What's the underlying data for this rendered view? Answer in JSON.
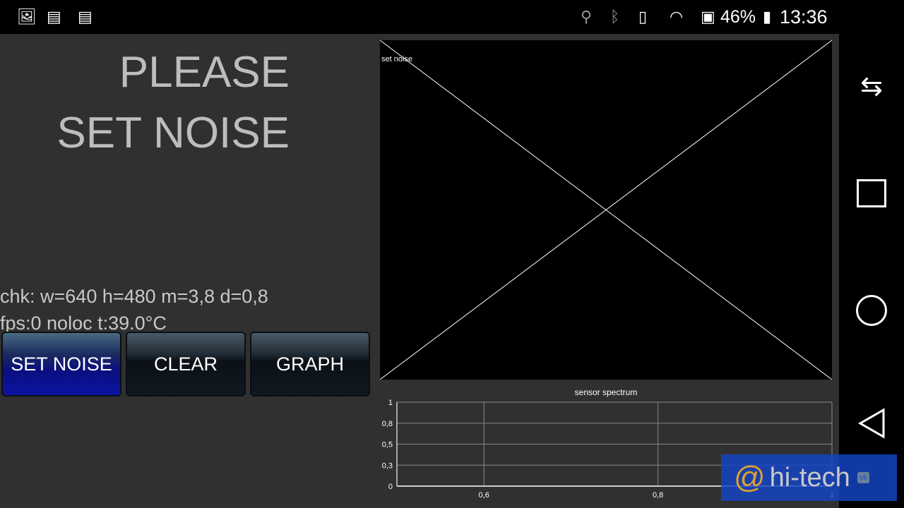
{
  "status_bar": {
    "battery": "46%",
    "time": "13:36",
    "left_icons": [
      "image-icon",
      "calendar-icon",
      "calendar-icon"
    ],
    "right_icons": [
      "location-icon",
      "bluetooth-icon",
      "vibrate-icon",
      "wifi-icon",
      "sd-card-icon",
      "battery-charging-icon"
    ]
  },
  "main": {
    "title_line1": "PLEASE",
    "title_line2": "SET NOISE",
    "info_line1": "chk: w=640 h=480 m=3,8 d=0,8",
    "info_line2": "fps:0 noloc t:39.0°C",
    "buttons": [
      {
        "label": "SET NOISE",
        "active": true
      },
      {
        "label": "CLEAR"
      },
      {
        "label": "GRAPH"
      }
    ],
    "preview_label": "set noise"
  },
  "chart_data": {
    "type": "line",
    "title": "sensor spectrum",
    "xlim": [
      0.5,
      1
    ],
    "ylim": [
      0,
      1
    ],
    "x_ticks": [
      {
        "v": 0.6,
        "label": "0,6"
      },
      {
        "v": 0.8,
        "label": "0,8"
      },
      {
        "v": 1,
        "label": "1"
      }
    ],
    "y_ticks": [
      {
        "v": 0,
        "label": "0"
      },
      {
        "v": 0.25,
        "label": "0,3"
      },
      {
        "v": 0.5,
        "label": "0,5"
      },
      {
        "v": 0.75,
        "label": "0,8"
      },
      {
        "v": 1,
        "label": "1"
      }
    ],
    "grid": true,
    "series": []
  },
  "navbar": {
    "icons": [
      "rotate-icon",
      "recents-icon",
      "home-icon",
      "back-icon"
    ]
  },
  "watermark": {
    "text": "hi-tech",
    "accent": "#e0a030"
  }
}
